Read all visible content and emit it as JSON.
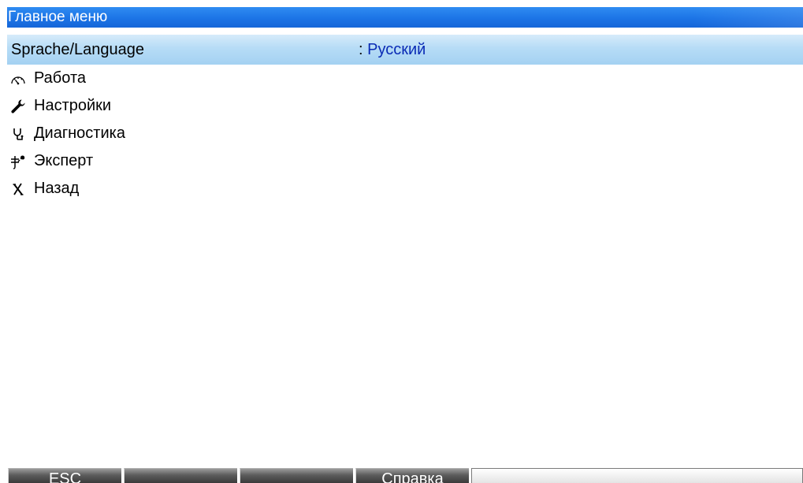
{
  "window": {
    "title": "Главное меню"
  },
  "menu": {
    "language": {
      "label": "Sprache/Language",
      "separator": ": ",
      "value": "Русский"
    },
    "items": [
      {
        "icon": "gauge-icon",
        "label": "Работа"
      },
      {
        "icon": "wrench-icon",
        "label": "Настройки"
      },
      {
        "icon": "stethoscope-icon",
        "label": "Диагностика"
      },
      {
        "icon": "expert-tools-icon",
        "label": "Эксперт"
      },
      {
        "icon": "back-x-icon",
        "label": "Назад"
      }
    ]
  },
  "softkeys": {
    "k1": "ESC",
    "k2": "",
    "k3": "",
    "k4": "Справка"
  },
  "colors": {
    "title_bar": "#1c74e6",
    "selected_row": "#b6dcf6",
    "value_text": "#0a2bb5",
    "softkey": "#5c5c5c"
  }
}
